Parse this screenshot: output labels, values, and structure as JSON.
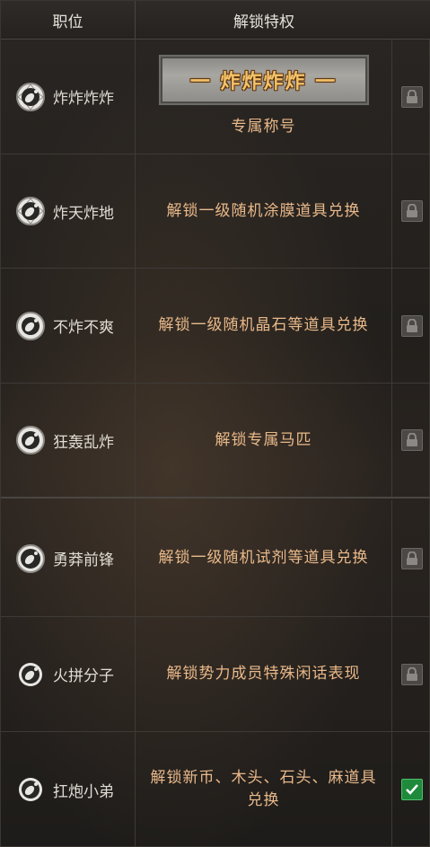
{
  "header": {
    "position_label": "职位",
    "privilege_label": "解锁特权"
  },
  "title_banner_text": "一 炸炸炸炸 一",
  "rows": [
    {
      "rank": "炸炸炸炸",
      "privilege": "专属称号",
      "status": "locked",
      "status_icon": "lock-icon"
    },
    {
      "rank": "炸天炸地",
      "privilege": "解锁一级随机涂膜道具兑换",
      "status": "locked",
      "status_icon": "lock-icon"
    },
    {
      "rank": "不炸不爽",
      "privilege": "解锁一级随机晶石等道具兑换",
      "status": "locked",
      "status_icon": "lock-icon"
    },
    {
      "rank": "狂轰乱炸",
      "privilege": "解锁专属马匹",
      "status": "locked",
      "status_icon": "lock-icon"
    },
    {
      "rank": "勇莽前锋",
      "privilege": "解锁一级随机试剂等道具兑换",
      "status": "locked",
      "status_icon": "lock-icon"
    },
    {
      "rank": "火拼分子",
      "privilege": "解锁势力成员特殊闲话表现",
      "status": "locked",
      "status_icon": "lock-icon"
    },
    {
      "rank": "扛炮小弟",
      "privilege": "解锁新币、木头、石头、麻道具兑换",
      "status": "unlocked",
      "status_icon": "check-icon"
    }
  ],
  "colors": {
    "privilege_text": "#e9b98a",
    "unlocked": "#1f8a3c",
    "locked": "#4b4845"
  }
}
